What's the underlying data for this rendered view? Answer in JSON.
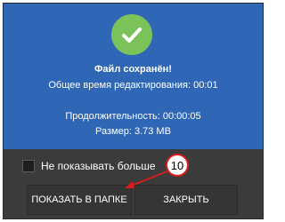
{
  "dialog": {
    "title": "Файл сохранён!",
    "total_time": "Общее время редактирования: 00:01",
    "duration": "Продолжительность: 00:00:05",
    "size": "Размер: 3.73 MB",
    "dont_show_label": "Не показывать больше",
    "dont_show_checked": false,
    "show_in_folder_label": "ПОКАЗАТЬ В ПАПКЕ",
    "close_label": "ЗАКРЫТЬ",
    "icon": "checkmark-icon"
  },
  "annotation": {
    "step_number": "10",
    "color": "#d71c1c"
  },
  "colors": {
    "header_blue": "#2f67b6",
    "success_green": "#7cc25a",
    "footer_dark": "#3b3b3b"
  }
}
